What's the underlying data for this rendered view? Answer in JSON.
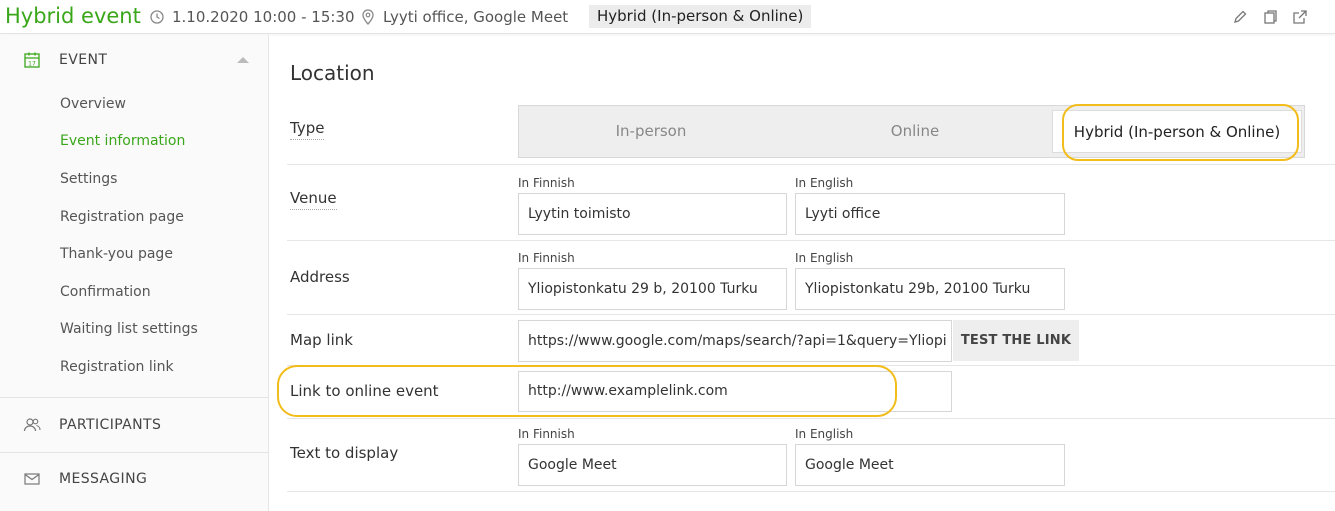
{
  "header": {
    "title": "Hybrid event",
    "datetime": "1.10.2020 10:00 - 15:30",
    "location": "Lyyti office, Google Meet",
    "type_badge": "Hybrid (In-person & Online)",
    "icons": [
      "clock-icon",
      "location-pin-icon",
      "pencil-icon",
      "copy-icon",
      "external-link-icon"
    ]
  },
  "sidebar": {
    "event_section": "EVENT",
    "items": [
      {
        "label": "Overview"
      },
      {
        "label": "Event information"
      },
      {
        "label": "Settings"
      },
      {
        "label": "Registration page"
      },
      {
        "label": "Thank-you page"
      },
      {
        "label": "Confirmation"
      },
      {
        "label": "Waiting list settings"
      },
      {
        "label": "Registration link"
      }
    ],
    "active_item": "Event information",
    "participants_section": "PARTICIPANTS",
    "messaging_section": "MESSAGING"
  },
  "main": {
    "heading": "Location",
    "type": {
      "label": "Type",
      "options": [
        "In-person",
        "Online",
        "Hybrid (In-person & Online)"
      ],
      "selected": "Hybrid (In-person & Online)"
    },
    "venue": {
      "label": "Venue",
      "finnish_label": "In Finnish",
      "finnish_value": "Lyytin toimisto",
      "english_label": "In English",
      "english_value": "Lyyti office"
    },
    "address": {
      "label": "Address",
      "finnish_label": "In Finnish",
      "finnish_value": "Yliopistonkatu 29 b, 20100 Turku",
      "english_label": "In English",
      "english_value": "Yliopistonkatu 29b, 20100 Turku"
    },
    "map_link": {
      "label": "Map link",
      "value": "https://www.google.com/maps/search/?api=1&query=Yliopi",
      "button": "TEST THE LINK"
    },
    "online_link": {
      "label": "Link to online event",
      "value": "http://www.examplelink.com"
    },
    "display_text": {
      "label": "Text to display",
      "finnish_label": "In Finnish",
      "finnish_value": "Google Meet",
      "english_label": "In English",
      "english_value": "Google Meet"
    }
  },
  "colors": {
    "accent_green": "#3aa71a",
    "highlight_yellow": "#f2bc1b"
  }
}
